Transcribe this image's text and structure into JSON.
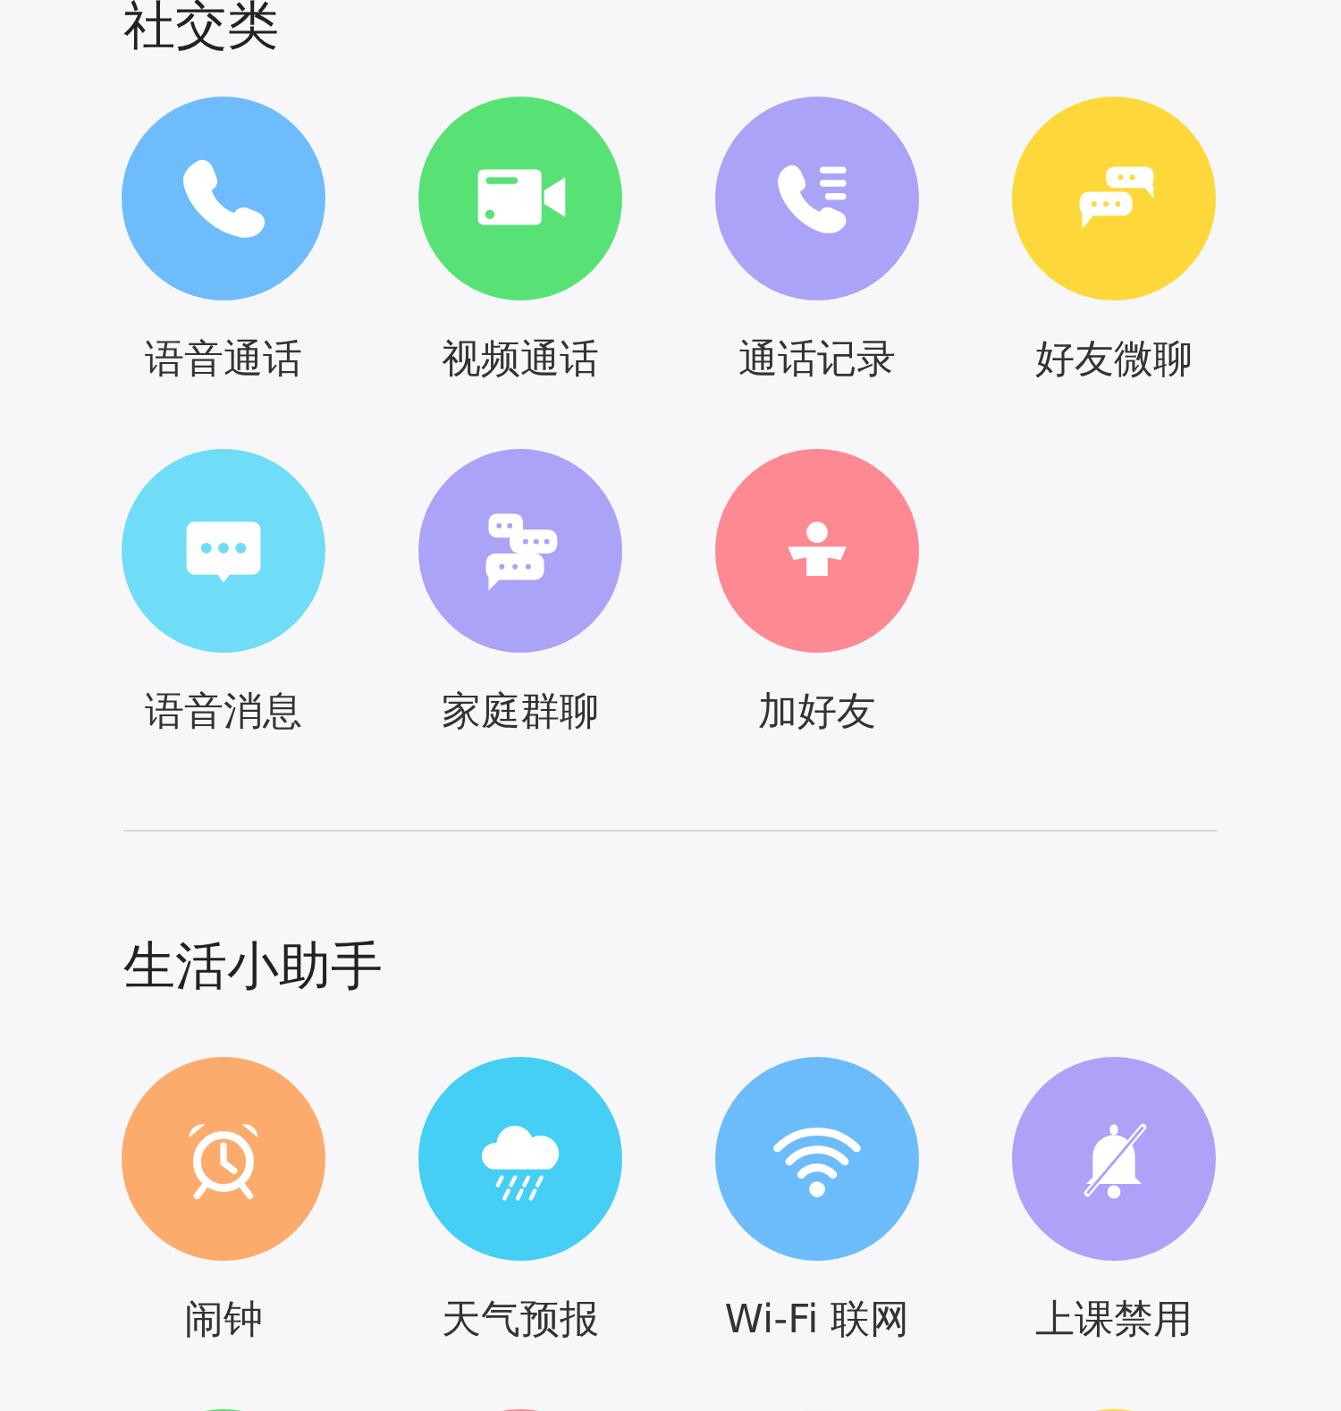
{
  "sections": [
    {
      "title": "社交类",
      "rows": [
        [
          {
            "label": "语音通话",
            "kind": "phone",
            "color": "#6fbcfd"
          },
          {
            "label": "视频通话",
            "kind": "video",
            "color": "#58e276"
          },
          {
            "label": "通话记录",
            "kind": "calllog",
            "color": "#aba3f7"
          },
          {
            "label": "好友微聊",
            "kind": "chat",
            "color": "#fed83a"
          }
        ],
        [
          {
            "label": "语音消息",
            "kind": "message",
            "color": "#6fddf7"
          },
          {
            "label": "家庭群聊",
            "kind": "group",
            "color": "#aba3f7"
          },
          {
            "label": "加好友",
            "kind": "person",
            "color": "#fd8a93"
          }
        ]
      ]
    },
    {
      "title": "生活小助手",
      "rows": [
        [
          {
            "label": "闹钟",
            "kind": "alarm",
            "color": "#fdab6c"
          },
          {
            "label": "天气预报",
            "kind": "weather",
            "color": "#45cff4"
          },
          {
            "label": "Wi-Fi 联网",
            "kind": "wifi",
            "color": "#6cbcfc"
          },
          {
            "label": "上课禁用",
            "kind": "belloff",
            "color": "#aea2f8"
          }
        ],
        [
          {
            "color": "#58e276"
          },
          {
            "color": "#fd8a93"
          },
          {
            "color": "#f3f3f6"
          },
          {
            "color": "#fed83a"
          }
        ]
      ]
    }
  ]
}
